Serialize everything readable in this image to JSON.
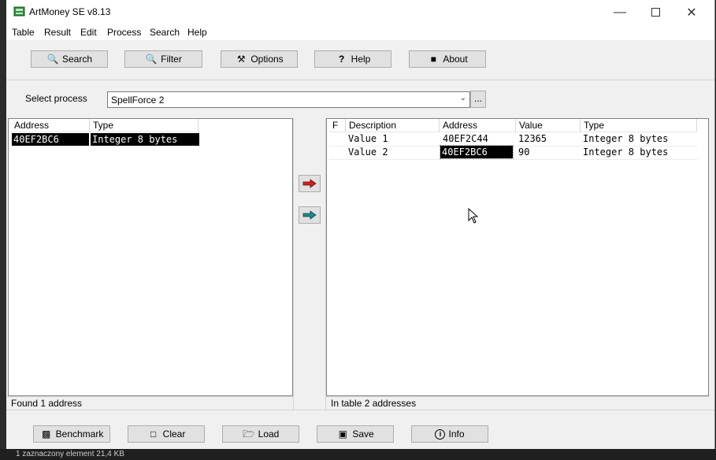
{
  "window": {
    "title": "ArtMoney SE v8.13"
  },
  "menu": [
    "Table",
    "Result",
    "Edit",
    "Process",
    "Search",
    "Help"
  ],
  "toolbar": {
    "search": "Search",
    "filter": "Filter",
    "options": "Options",
    "help": "Help",
    "about": "About"
  },
  "process": {
    "label": "Select process",
    "value": "SpellForce 2",
    "browse": "..."
  },
  "left_table": {
    "headers": [
      "Address",
      "Type"
    ],
    "rows": [
      {
        "address": "40EF2BC6",
        "type": "Integer 8 bytes"
      }
    ]
  },
  "right_table": {
    "headers": [
      "F",
      "Description",
      "Address",
      "Value",
      "Type"
    ],
    "rows": [
      {
        "f": "",
        "description": "Value 1",
        "address": "40EF2C44",
        "value": "12365",
        "type": "Integer 8 bytes"
      },
      {
        "f": "",
        "description": "Value 2",
        "address": "40EF2BC6",
        "value": "90",
        "type": "Integer 8 bytes"
      }
    ]
  },
  "status": {
    "left": "Found 1 address",
    "right": "In table 2 addresses"
  },
  "bottom": {
    "benchmark": "Benchmark",
    "clear": "Clear",
    "load": "Load",
    "save": "Save",
    "info": "Info"
  },
  "taskbar": {
    "text": "1 zaznaczony element  21,4 KB"
  },
  "colors": {
    "add_arrow": "#d02020",
    "transfer_arrow": "#1a8a8a",
    "selection": "#000000"
  }
}
